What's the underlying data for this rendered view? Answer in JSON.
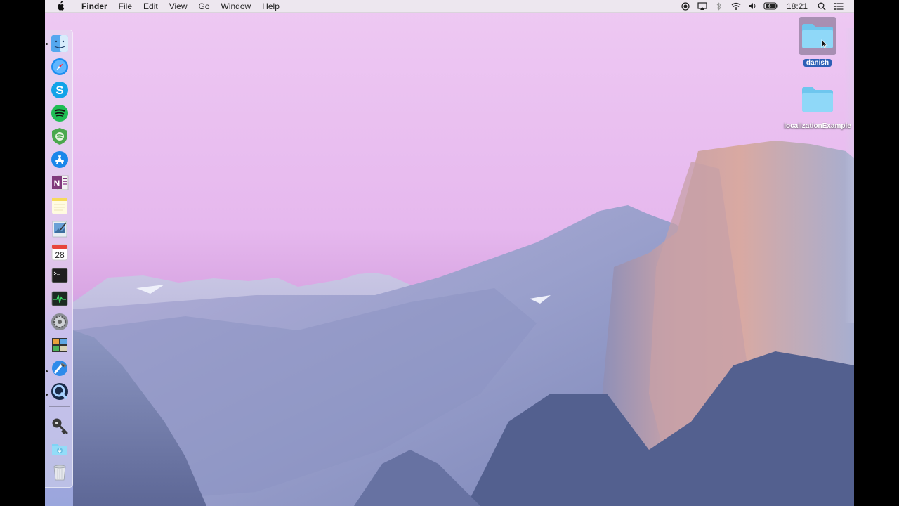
{
  "menubar": {
    "apple_icon": "apple-logo-icon",
    "items": [
      "Finder",
      "File",
      "Edit",
      "View",
      "Go",
      "Window",
      "Help"
    ],
    "status_icons": [
      "record-icon",
      "airplay-icon",
      "bluetooth-icon",
      "wifi-icon",
      "volume-icon",
      "battery-icon"
    ],
    "clock": "18:21",
    "search_icon": "spotlight-icon",
    "notifications_icon": "notification-center-icon"
  },
  "dock": {
    "items": [
      {
        "name": "finder-icon",
        "running": true
      },
      {
        "name": "safari-icon",
        "running": false
      },
      {
        "name": "skype-icon",
        "running": false
      },
      {
        "name": "spotify-icon",
        "running": false
      },
      {
        "name": "vpn-shield-icon",
        "running": false
      },
      {
        "name": "app-store-icon",
        "running": false
      },
      {
        "name": "onenote-icon",
        "running": false
      },
      {
        "name": "notes-icon",
        "running": false
      },
      {
        "name": "preview-icon",
        "running": false
      },
      {
        "name": "calendar-icon",
        "running": false,
        "label": "28"
      },
      {
        "name": "terminal-icon",
        "running": false
      },
      {
        "name": "activity-monitor-icon",
        "running": false
      },
      {
        "name": "system-preferences-icon",
        "running": false
      },
      {
        "name": "photos-grid-icon",
        "running": false
      },
      {
        "name": "xcode-icon",
        "running": true
      },
      {
        "name": "quicktime-icon",
        "running": true
      },
      {
        "name": "keychain-icon",
        "running": false
      },
      {
        "name": "downloads-folder-icon",
        "running": false
      },
      {
        "name": "trash-icon",
        "running": false
      }
    ]
  },
  "desktop": {
    "icons": [
      {
        "label": "danish",
        "selected": true
      },
      {
        "label": "localizationExample",
        "selected": false
      }
    ]
  },
  "colors": {
    "sky_top": "#f1c6f0",
    "sky_mid": "#e2b6ee",
    "sky_horizon": "#c8a6ec",
    "mountain": "#8a92c2",
    "rock": "#c9a3a8",
    "folder": "#7fd3f5",
    "selection": "#2d5fb6"
  }
}
